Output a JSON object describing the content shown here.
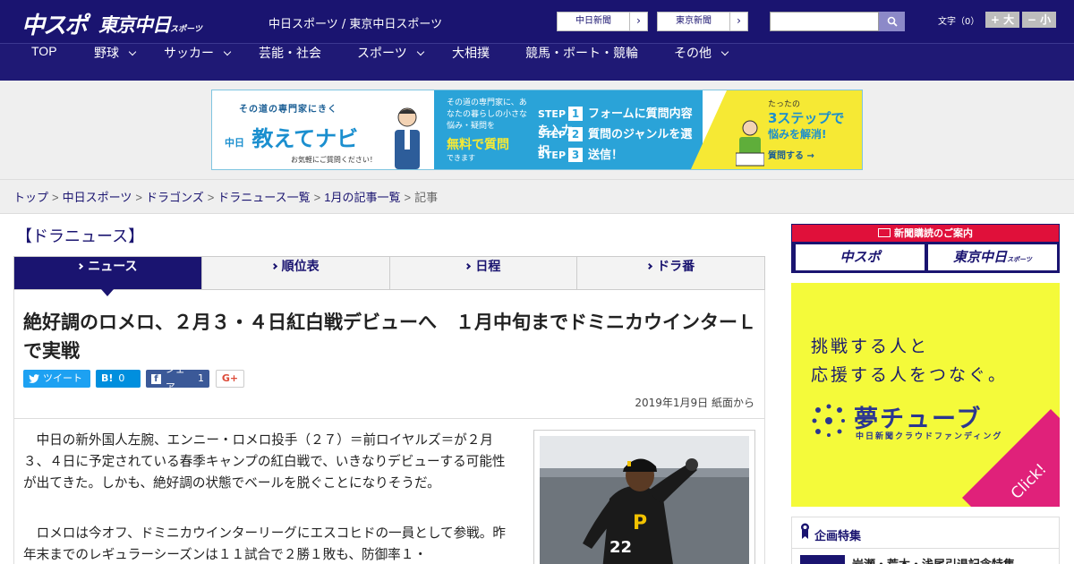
{
  "header": {
    "logo_main": "中スポ",
    "logo_tokyo": "東京中日",
    "logo_tokyo_sub": "スポーツ",
    "site_names": "中日スポーツ / 東京中日スポーツ",
    "ext_links": [
      {
        "label": "中日新聞"
      },
      {
        "label": "東京新聞"
      }
    ],
    "search": {
      "value": "",
      "placeholder": ""
    },
    "font_size": {
      "label": "文字（0）",
      "increase": "+ 大",
      "decrease": "− 小"
    }
  },
  "nav": {
    "items": [
      {
        "label": "TOP",
        "dropdown": false
      },
      {
        "label": "野球",
        "dropdown": true
      },
      {
        "label": "サッカー",
        "dropdown": true
      },
      {
        "label": "芸能・社会",
        "dropdown": false
      },
      {
        "label": "スポーツ",
        "dropdown": true
      },
      {
        "label": "大相撲",
        "dropdown": false
      },
      {
        "label": "競馬・ボート・競輪",
        "dropdown": false
      },
      {
        "label": "その他",
        "dropdown": true
      }
    ]
  },
  "ad_banner": {
    "left_tagline": "その道の専門家にきく",
    "left_brand_prefix": "中日",
    "left_brand": "教えてナビ",
    "left_note": "お気軽にご質問ください！",
    "mid_text": "その道の専門家に、あなたの暮らしの小さな悩み・疑問を",
    "mid_highlight": "無料で質問",
    "mid_sub": "できます",
    "steps": [
      {
        "step": "STEP",
        "num": "1",
        "text": "フォームに質問内容を入力"
      },
      {
        "step": "STEP",
        "num": "2",
        "text": "質問のジャンルを選択"
      },
      {
        "step": "STEP",
        "num": "3",
        "text": "送信！"
      }
    ],
    "right_small": "たったの",
    "right_big": "3ステップで",
    "right_mid": "悩みを解消!",
    "right_cta": "質問する →"
  },
  "breadcrumb": {
    "links": [
      "トップ",
      "中日スポーツ",
      "ドラゴンズ",
      "ドラニュース一覧",
      "1月の記事一覧"
    ],
    "current": "記事",
    "separator": ">"
  },
  "main": {
    "section_title": "【ドラニュース】",
    "tabs": [
      {
        "label": "ニュース",
        "active": true
      },
      {
        "label": "順位表",
        "active": false
      },
      {
        "label": "日程",
        "active": false
      },
      {
        "label": "ドラ番",
        "active": false
      }
    ],
    "headline": "絶好調のロメロ、２月３・４日紅白戦デビューへ　１月中旬までドミニカウインターＬで実戦",
    "share": {
      "tweet_label": "ツイート",
      "hatena_label": "B!",
      "hatena_count": "0",
      "facebook_label": "シェア",
      "facebook_count": "1",
      "gplus_label": "G+"
    },
    "date": "2019年1月9日 紙面から",
    "paragraphs": [
      "中日の新外国人左腕、エンニー・ロメロ投手（２７）＝前ロイヤルズ＝が２月３、４日に予定されている春季キャンプの紅白戦で、いきなりデビューする可能性が出てきた。しかも、絶好調の状態でベールを脱ぐことになりそうだ。",
      "ロメロは今オフ、ドミニカウインターリーグにエスコヒドの一員として参戦。昨年末までのレギュラーシーズンは１１試合で２勝１敗も、防御率１・"
    ],
    "photo_jersey": "22",
    "photo_cap": "P"
  },
  "sidebar": {
    "subscription": {
      "header": "新聞購読のご案内",
      "logo_chuspo": "中スポ",
      "logo_tokyo": "東京中日",
      "logo_tokyo_sub": "スポーツ"
    },
    "ad": {
      "line1": "挑戦する人と",
      "line2": "応援する人をつなぐ。",
      "brand": "夢チューブ",
      "brand_sub": "中日新聞クラウドファンディング",
      "click": "Click!"
    },
    "kikaku": {
      "title": "企画特集",
      "item": "岩瀬・荒木・浅尾引退記念特集"
    }
  },
  "colors": {
    "brand_navy": "#1a1470",
    "accent_red": "#e0103a",
    "ad_blue": "#2aa3d8",
    "ad_yellow": "#f6e934"
  }
}
